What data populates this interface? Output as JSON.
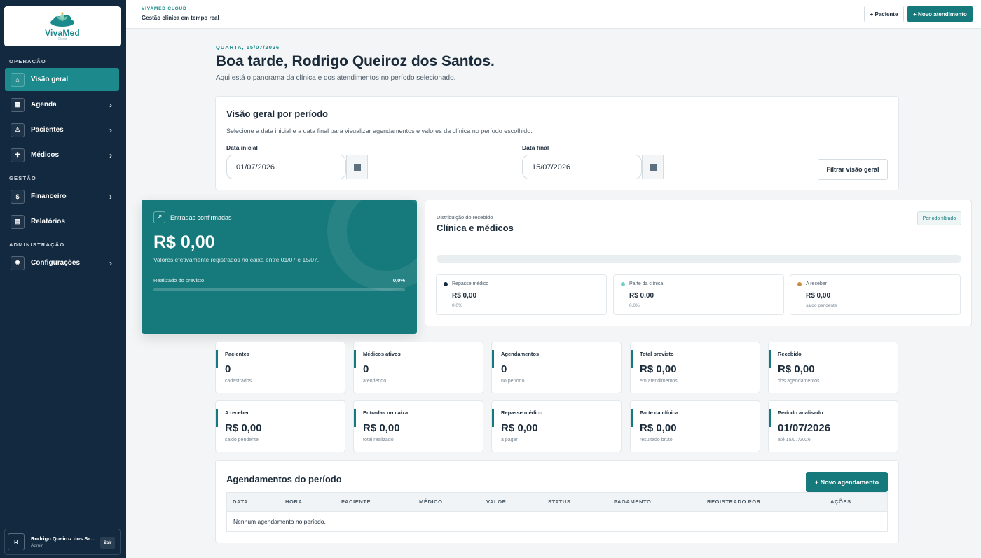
{
  "sidebar": {
    "logo_text": "VivaMed",
    "logo_sub": "Cloud",
    "sections": {
      "operacao": "OPERAÇÃO",
      "gestao": "GESTÃO",
      "administracao": "ADMINISTRAÇÃO"
    },
    "items": [
      {
        "label": "Visão geral",
        "icon": "home-icon"
      },
      {
        "label": "Agenda",
        "icon": "calendar-icon"
      },
      {
        "label": "Pacientes",
        "icon": "user-icon"
      },
      {
        "label": "Médicos",
        "icon": "plus-icon"
      },
      {
        "label": "Financeiro",
        "icon": "dollar-icon"
      },
      {
        "label": "Relatórios",
        "icon": "report-icon"
      },
      {
        "label": "Configurações",
        "icon": "gear-icon"
      }
    ],
    "user": {
      "initial": "R",
      "name": "Rodrigo Queiroz dos Santos",
      "role": "Admin",
      "logout": "Sair"
    }
  },
  "topbar": {
    "brand": "VIVAMED CLOUD",
    "subtitle": "Gestão clínica em tempo real",
    "btn_paciente": "+ Paciente",
    "btn_atendimento": "+ Novo atendimento"
  },
  "header": {
    "kicker": "QUARTA, 15/07/2026",
    "greeting": "Boa tarde, Rodrigo Queiroz dos Santos.",
    "intro": "Aqui está o panorama da clínica e dos atendimentos no período selecionado."
  },
  "period": {
    "title": "Visão geral por período",
    "desc": "Selecione a data inicial e a data final para visualizar agendamentos e valores da clínica no período escolhido.",
    "start_label": "Data inicial",
    "start_value": "01/07/2026",
    "end_label": "Data final",
    "end_value": "15/07/2026",
    "filter_btn": "Filtrar visão geral"
  },
  "hero": {
    "label": "Entradas confirmadas",
    "value": "R$ 0,00",
    "desc": "Valores efetivamente registrados no caixa entre 01/07 e 15/07.",
    "progress_label": "Realizado do previsto",
    "progress_value": "0,0%",
    "progress_fraction": 0
  },
  "distribution": {
    "kicker": "Distribuição do recebido",
    "title": "Clínica e médicos",
    "pill": "Período filtrado",
    "items": [
      {
        "label": "Repasse médico",
        "value": "R$ 0,00",
        "sub": "0,0%",
        "color": "#12293f"
      },
      {
        "label": "Parte da clínica",
        "value": "R$ 0,00",
        "sub": "0,0%",
        "color": "#6fd0c4"
      },
      {
        "label": "A receber",
        "value": "R$ 0,00",
        "sub": "saldo pendente",
        "color": "#c98a3d"
      }
    ]
  },
  "stats": [
    {
      "label": "Pacientes",
      "value": "0",
      "sub": "cadastrados"
    },
    {
      "label": "Médicos ativos",
      "value": "0",
      "sub": "atendendo"
    },
    {
      "label": "Agendamentos",
      "value": "0",
      "sub": "no período"
    },
    {
      "label": "Total previsto",
      "value": "R$ 0,00",
      "sub": "em atendimentos"
    },
    {
      "label": "Recebido",
      "value": "R$ 0,00",
      "sub": "dos agendamentos"
    },
    {
      "label": "A receber",
      "value": "R$ 0,00",
      "sub": "saldo pendente"
    },
    {
      "label": "Entradas no caixa",
      "value": "R$ 0,00",
      "sub": "total realizado"
    },
    {
      "label": "Repasse médico",
      "value": "R$ 0,00",
      "sub": "a pagar"
    },
    {
      "label": "Parte da clínica",
      "value": "R$ 0,00",
      "sub": "resultado bruto"
    },
    {
      "label": "Período analisado",
      "value": "01/07/2026",
      "sub": "até 15/07/2026"
    }
  ],
  "appointments": {
    "title": "Agendamentos do período",
    "new_btn": "+ Novo agendamento",
    "columns": [
      "DATA",
      "HORA",
      "PACIENTE",
      "MÉDICO",
      "VALOR",
      "STATUS",
      "PAGAMENTO",
      "REGISTRADO POR",
      "AÇÕES"
    ],
    "empty": "Nenhum agendamento no período."
  }
}
